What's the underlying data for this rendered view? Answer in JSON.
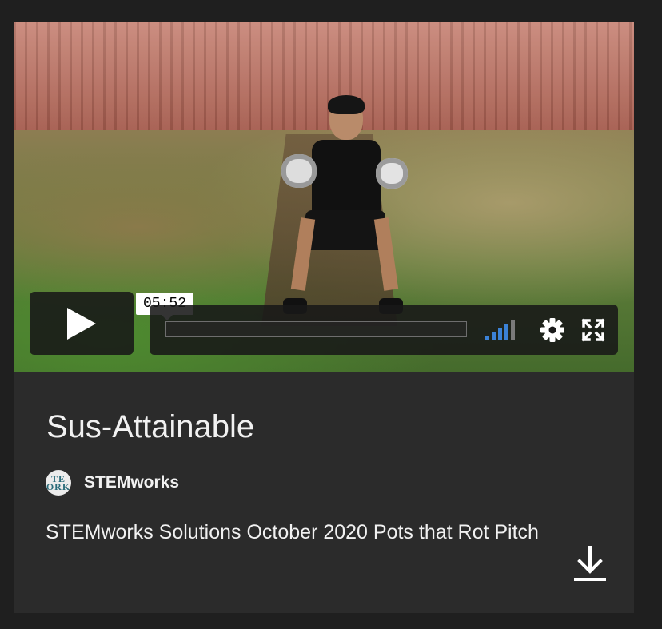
{
  "video": {
    "thumbnail": "person-sitting-on-stairs-holding-pots",
    "time_tooltip": "05:52",
    "progress_fraction": 0.0,
    "play_icon": "play-icon",
    "volume_icon": "volume-bars-icon",
    "volume_level_bars": 4,
    "volume_total_bars": 5,
    "settings_icon": "gear-icon",
    "fullscreen_icon": "fullscreen-icon"
  },
  "info": {
    "title": "Sus-Attainable",
    "channel": {
      "avatar_text": "TE\nORK",
      "name": "STEMworks"
    },
    "description": "STEMworks Solutions October 2020 Pots that Rot Pitch",
    "download_icon": "download-icon"
  },
  "colors": {
    "page_bg": "#1f1f1f",
    "card_bg": "#2b2b2b",
    "accent_blue": "#3b82d6",
    "text": "#f1f1f1"
  }
}
